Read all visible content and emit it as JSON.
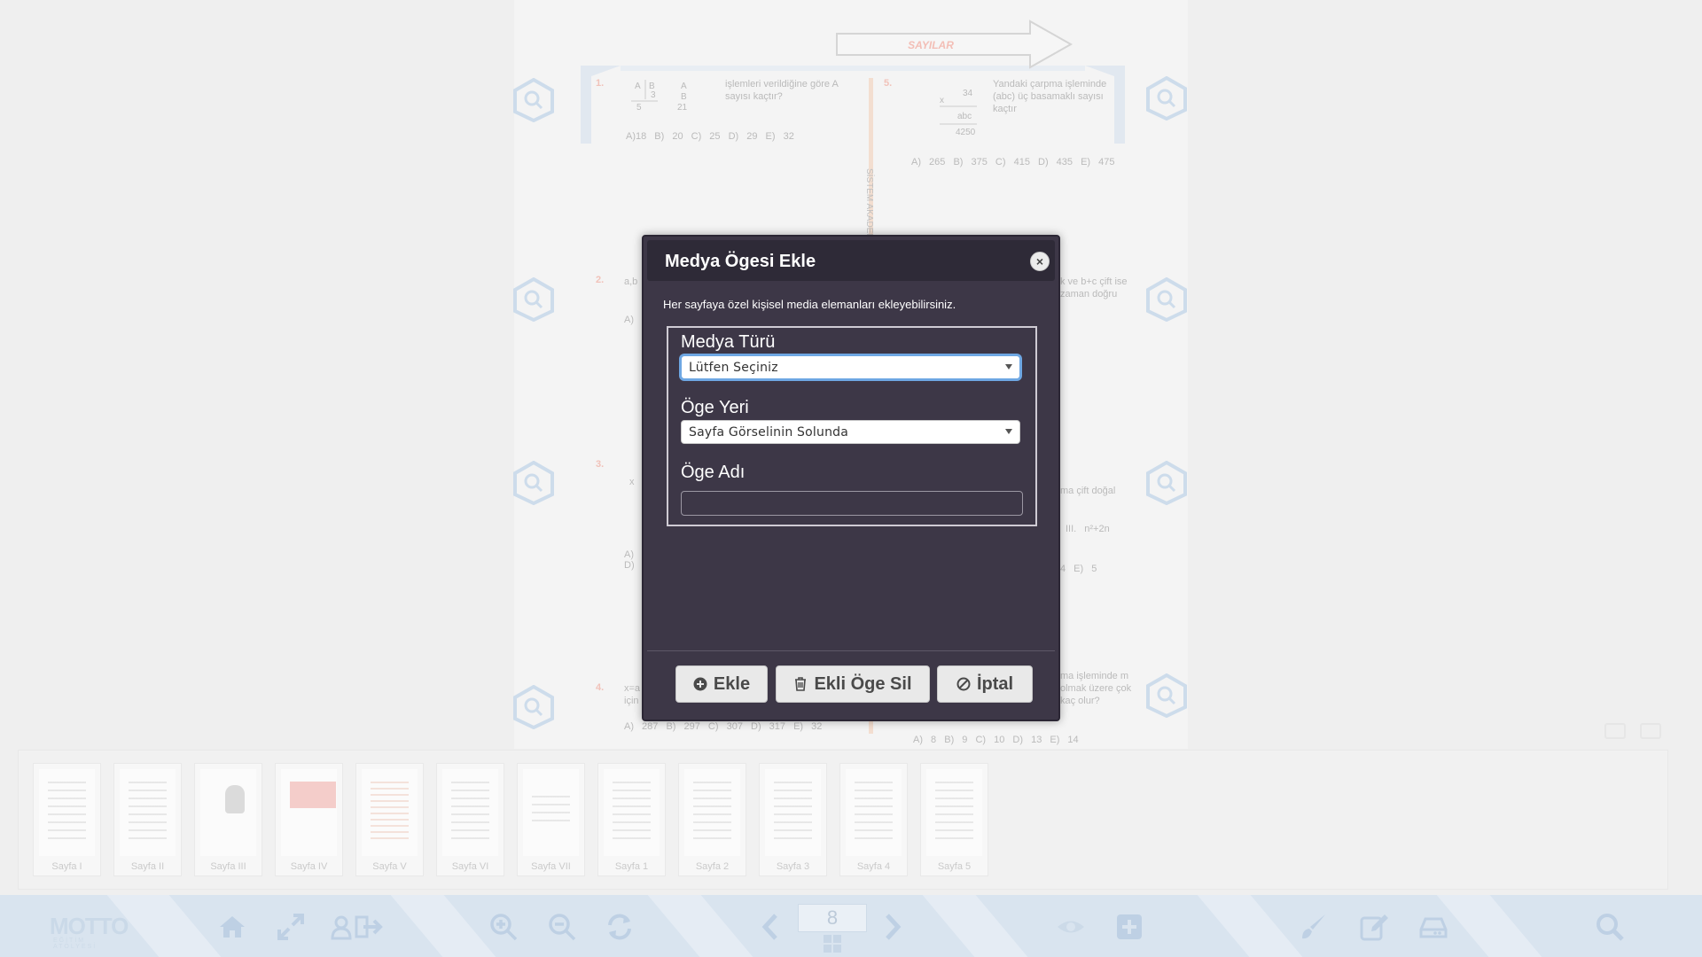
{
  "book": {
    "arrow_label": "SAYILAR",
    "column_label": "SİSTEM AKADEMİ",
    "questions": [
      {
        "num": "1.",
        "text": "işlemleri verildiğine göre A sayısı kaçtır?",
        "options": "A)18 B) 20 C) 25 D) 29 E) 32"
      },
      {
        "num": "2.",
        "text": "a,b",
        "options": "A)"
      },
      {
        "num": "3.",
        "text": "x",
        "options": "A) D)"
      },
      {
        "num": "4.",
        "text": "x=a için",
        "options": "A) 287 B) 297 C) 307 D) 317 E) 32"
      },
      {
        "num": "5.",
        "text": "Yandaki çarpma işleminde (abc) üç basamaklı sayısı kaçtır",
        "options": "A) 265 B) 375 C) 415 D) 435 E) 475",
        "figure": [
          "34",
          "x",
          "abc",
          "4250"
        ]
      },
      {
        "num": "",
        "text": "k ve b+c çift ise zaman doğru",
        "options": ""
      },
      {
        "num": "",
        "text": "ma çift doğal",
        "options": "III. n²+2n"
      },
      {
        "num": "",
        "text": "",
        "options": "4 E) 5"
      },
      {
        "num": "",
        "text": "ma işleminde m olmak üzere çok kaç olur?",
        "options": "A) 8 B) 9 C) 10 D) 13 E) 14"
      }
    ],
    "q1_fraction": [
      "A",
      "B",
      "5",
      "3",
      "A",
      "B",
      "21"
    ]
  },
  "thumbnails": [
    {
      "label": "Sayfa I"
    },
    {
      "label": "Sayfa II"
    },
    {
      "label": "Sayfa III"
    },
    {
      "label": "Sayfa IV"
    },
    {
      "label": "Sayfa V"
    },
    {
      "label": "Sayfa VI"
    },
    {
      "label": "Sayfa VII"
    },
    {
      "label": "Sayfa 1"
    },
    {
      "label": "Sayfa 2"
    },
    {
      "label": "Sayfa 3"
    },
    {
      "label": "Sayfa 4"
    },
    {
      "label": "Sayfa 5"
    }
  ],
  "toolbar": {
    "brand": "MOTTO",
    "brand_sub": "EĞİTİM ATÖLYESİ",
    "page_number": "8",
    "icons": [
      "home-icon",
      "fullscreen-icon",
      "user-logout-icon",
      "zoom-in-icon",
      "zoom-out-icon",
      "refresh-icon",
      "prev-page-icon",
      "next-page-icon",
      "eye-icon",
      "plus-icon",
      "brush-icon",
      "edit-icon",
      "drive-icon",
      "search-icon"
    ]
  },
  "modal": {
    "title": "Medya Ögesi Ekle",
    "close": "×",
    "description": "Her sayfaya özel kişisel media elemanları ekleyebilirsiniz.",
    "media_type_label": "Medya Türü",
    "media_type_value": "Lütfen Seçiniz",
    "location_label": "Öge Yeri",
    "location_value": "Sayfa Görselinin Solunda",
    "name_label": "Öge Adı",
    "name_value": "",
    "buttons": {
      "add": "Ekle",
      "delete": "Ekli Öge Sil",
      "cancel": "İptal"
    }
  },
  "colors": {
    "modal_bg": "#3d3747",
    "modal_header": "#2e2a37",
    "toolbar_bg": "#d6e2ee",
    "focus_ring": "#6ea7e3"
  }
}
